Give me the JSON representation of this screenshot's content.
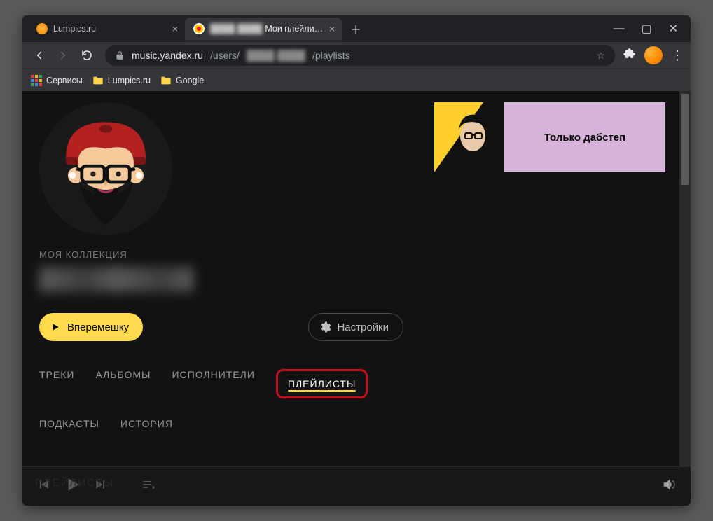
{
  "window": {
    "tabs": [
      {
        "title": "Lumpics.ru",
        "active": false
      },
      {
        "title": "Мои плейлисты на Я",
        "active": true
      }
    ]
  },
  "url": {
    "prefix": "music.yandex.ru",
    "path1": "/users/",
    "path2": "/playlists"
  },
  "bookmarks": {
    "apps": "Сервисы",
    "lumpics": "Lumpics.ru",
    "google": "Google"
  },
  "profile": {
    "section_label": "МОЯ КОЛЛЕКЦИЯ",
    "shuffle": "Вперемешку",
    "settings": "Настройки"
  },
  "nav": {
    "tracks": "ТРЕКИ",
    "albums": "АЛЬБОМЫ",
    "artists": "ИСПОЛНИТЕЛИ",
    "playlists": "ПЛЕЙЛИСТЫ",
    "podcasts": "ПОДКАСТЫ",
    "history": "ИСТОРИЯ"
  },
  "playlist_card": {
    "title": "Только дабстеп"
  }
}
